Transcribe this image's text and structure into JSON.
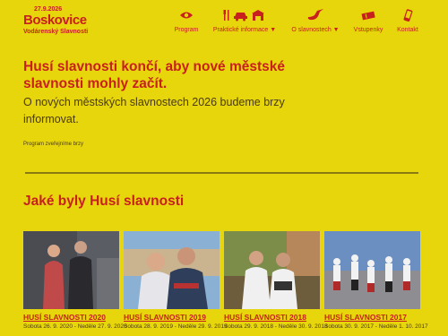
{
  "logo": {
    "line1": "27.9.2026",
    "line2": "Boskovice",
    "line3": "Vodárenský Slavnosti"
  },
  "nav": [
    {
      "label": "Program",
      "icon": "eye-icon"
    },
    {
      "label": "Praktické informace ▼",
      "icon": "info-icons"
    },
    {
      "label": "O slavnostech ▼",
      "icon": "goose-icon"
    },
    {
      "label": "Vstupenky",
      "icon": "ticket-icon"
    },
    {
      "label": "Kontakt",
      "icon": "phone-icon"
    }
  ],
  "main": {
    "headline": "Husí slavnosti končí, aby nové městské slavnosti mohly začít.",
    "lead": "O nových městských slavnostech 2026 budeme brzy informovat.",
    "small": "Program zveřejníme brzy"
  },
  "history": {
    "title": "Jaké byly Husí slavnosti",
    "cards": [
      {
        "title": "HUSÍ SLAVNOSTI 2020",
        "date": "Sobota 26. 9. 2020 - Neděle 27. 9. 2020"
      },
      {
        "title": "HUSÍ SLAVNOSTI 2019",
        "date": "Sobota 28. 9. 2019 - Neděle 29. 9. 2019"
      },
      {
        "title": "HUSÍ SLAVNOSTI 2018",
        "date": "Sobota 29. 9. 2018 - Neděle 30. 9. 2018"
      },
      {
        "title": "HUSÍ SLAVNOSTI 2017",
        "date": "Sobota 30. 9. 2017 - Neděle 1. 10. 2017"
      }
    ]
  },
  "colors": {
    "background": "#e8d60c",
    "accent": "#c8201e",
    "text": "#4a3b10"
  }
}
